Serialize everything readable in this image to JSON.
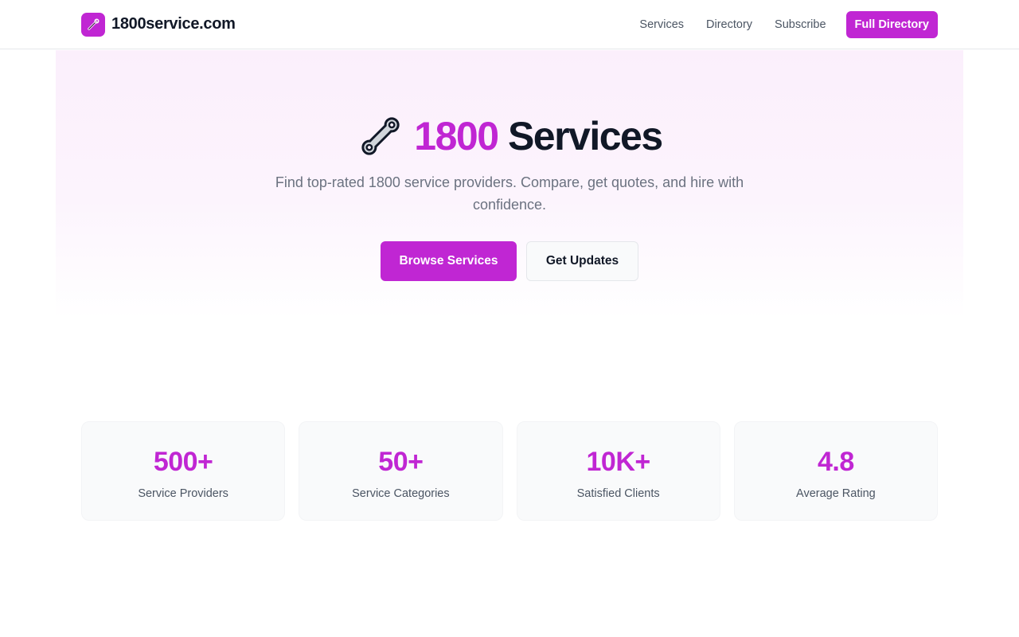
{
  "brand": {
    "name": "1800service.com",
    "icon": "wrench-icon"
  },
  "nav": {
    "links": [
      "Services",
      "Directory",
      "Subscribe"
    ],
    "cta": "Full Directory"
  },
  "hero": {
    "title_accent": "1800",
    "title_rest": "Services",
    "icon": "wrench-icon",
    "subtitle": "Find top-rated 1800 service providers. Compare, get quotes, and hire with confidence.",
    "primary_button": "Browse Services",
    "secondary_button": "Get Updates"
  },
  "stats": [
    {
      "value": "500+",
      "label": "Service Providers"
    },
    {
      "value": "50+",
      "label": "Service Categories"
    },
    {
      "value": "10K+",
      "label": "Satisfied Clients"
    },
    {
      "value": "4.8",
      "label": "Average Rating"
    }
  ],
  "colors": {
    "accent": "#c026d3",
    "text_dark": "#111827",
    "text_muted": "#6b7280",
    "card_bg": "#f9fafb"
  }
}
